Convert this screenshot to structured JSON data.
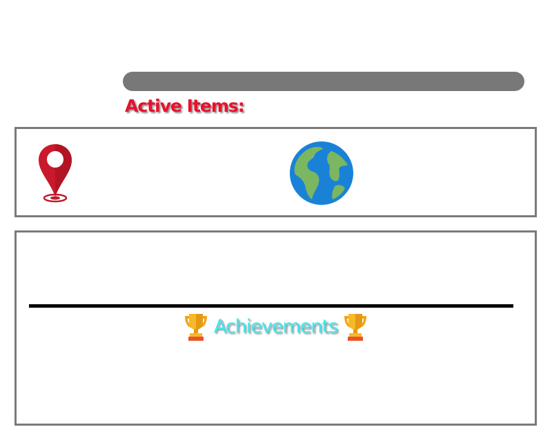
{
  "status_bar": {
    "progress": 1.0,
    "color": "#787878"
  },
  "active_items": {
    "heading": "Active Items:",
    "heading_color": "#e8112d",
    "items": [
      {
        "icon": "location-pin-icon"
      },
      {
        "icon": "globe-icon"
      }
    ]
  },
  "achievements": {
    "title": "Achievements",
    "title_color": "#3de8f0",
    "icon": "trophy-icon"
  }
}
